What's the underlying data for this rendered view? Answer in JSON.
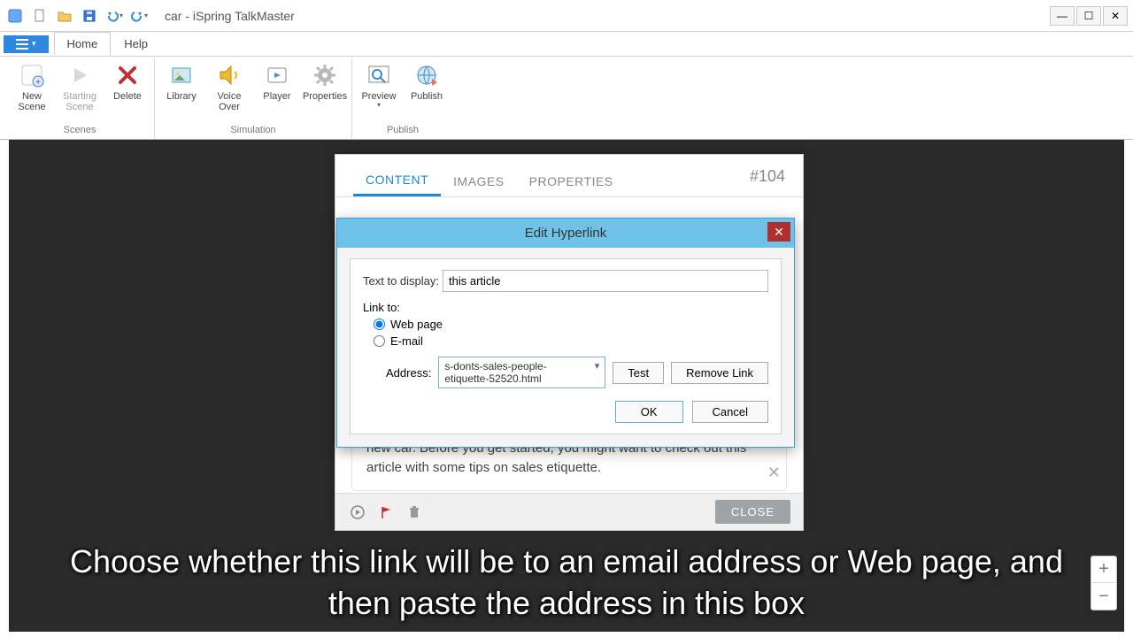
{
  "window": {
    "title": "car - iSpring TalkMaster"
  },
  "tabs": {
    "home": "Home",
    "help": "Help"
  },
  "ribbon": {
    "new_scene": "New\nScene",
    "starting_scene": "Starting\nScene",
    "delete": "Delete",
    "library": "Library",
    "voice_over": "Voice\nOver",
    "player": "Player",
    "properties": "Properties",
    "preview": "Preview",
    "publish": "Publish",
    "group_scenes": "Scenes",
    "group_simulation": "Simulation",
    "group_publish": "Publish"
  },
  "panel": {
    "tab_content": "CONTENT",
    "tab_images": "IMAGES",
    "tab_properties": "PROPERTIES",
    "scene_id": "#104",
    "message": "new car. Before you get started, you might want to check out this article with some tips on sales etiquette.",
    "close": "CLOSE"
  },
  "dialog": {
    "title": "Edit Hyperlink",
    "text_to_display_label": "Text to display:",
    "text_to_display_value": "this article",
    "link_to_label": "Link to:",
    "opt_web": "Web page",
    "opt_email": "E-mail",
    "address_label": "Address:",
    "address_value": "s-donts-sales-people-etiquette-52520.html",
    "test": "Test",
    "remove_link": "Remove Link",
    "ok": "OK",
    "cancel": "Cancel"
  },
  "caption": "Choose whether this link will be to an email address or Web page, and then paste the address in this box"
}
